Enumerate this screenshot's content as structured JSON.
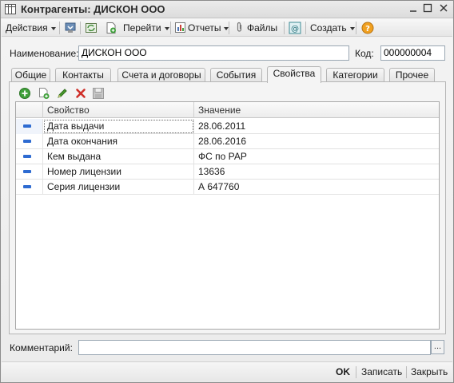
{
  "window": {
    "title": "Контрагенты: ДИСКОН  ООО"
  },
  "toolbar": {
    "actions_label": "Действия",
    "goto_label": "Перейти",
    "reports_label": "Отчеты",
    "files_label": "Файлы",
    "create_label": "Создать",
    "help_label": "?"
  },
  "form": {
    "name_label": "Наименование:",
    "name_value": "ДИСКОН  ООО",
    "code_label": "Код:",
    "code_value": "000000004"
  },
  "tabs": [
    {
      "label": "Общие"
    },
    {
      "label": "Контакты"
    },
    {
      "label": "Счета и договоры"
    },
    {
      "label": "События"
    },
    {
      "label": "Свойства"
    },
    {
      "label": "Категории"
    },
    {
      "label": "Прочее"
    }
  ],
  "active_tab": "Свойства",
  "properties_table": {
    "columns": [
      "Свойство",
      "Значение"
    ],
    "rows": [
      {
        "property": "Дата выдачи",
        "value": "28.06.2011"
      },
      {
        "property": "Дата окончания",
        "value": "28.06.2016"
      },
      {
        "property": "Кем выдана",
        "value": "ФС по РАР"
      },
      {
        "property": "Номер лицензии",
        "value": "13636"
      },
      {
        "property": "Серия лицензии",
        "value": "А 647760"
      }
    ]
  },
  "comment": {
    "label": "Комментарий:",
    "value": "",
    "button_label": "..."
  },
  "footer": {
    "ok_label": "OK",
    "save_label": "Записать",
    "close_label": "Закрыть"
  },
  "colors": {
    "row_icon": "#2e6bd1",
    "add_icon": "#3fa03a",
    "edit_icon": "#4a9c2d",
    "delete_icon": "#d0302a",
    "help_icon": "#f0a020"
  }
}
